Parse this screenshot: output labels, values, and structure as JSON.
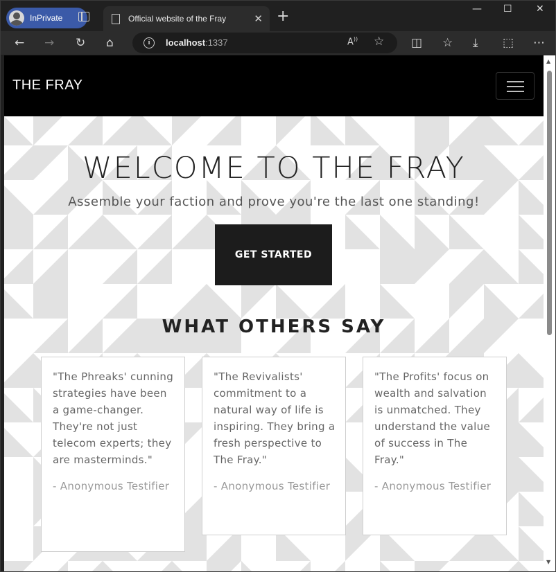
{
  "browser": {
    "profile_label": "InPrivate",
    "tab_title": "Official website of the Fray",
    "tab_close": "✕",
    "new_tab": "+",
    "url_host": "localhost",
    "url_port": ":1337",
    "controls": {
      "minimize": "—",
      "maximize": "☐",
      "close": "✕"
    }
  },
  "site": {
    "brand": "THE FRAY",
    "hero_title": "WELCOME TO THE FRAY",
    "hero_subtitle": "Assemble your faction and prove you're the last one standing!",
    "cta_label": "GET STARTED",
    "testimonials_heading": "WHAT OTHERS SAY",
    "testimonials": [
      {
        "quote": "\"The Phreaks' cunning strategies have been a game-changer. They're not just telecom experts; they are masterminds.\"",
        "author": "- Anonymous Testifier"
      },
      {
        "quote": "\"The Revivalists' commitment to a natural way of life is inspiring. They bring a fresh perspective to The Fray.\"",
        "author": "- Anonymous Testifier"
      },
      {
        "quote": "\"The Profits' focus on wealth and salvation is unmatched. They understand the value of success in The Fray.\"",
        "author": "- Anonymous Testifier"
      }
    ]
  },
  "colors": {
    "navbar": "#000000",
    "pattern": "#e2e2e2",
    "cta_background": "#1c1c1c",
    "profile_badge": "#3b5aa8"
  }
}
